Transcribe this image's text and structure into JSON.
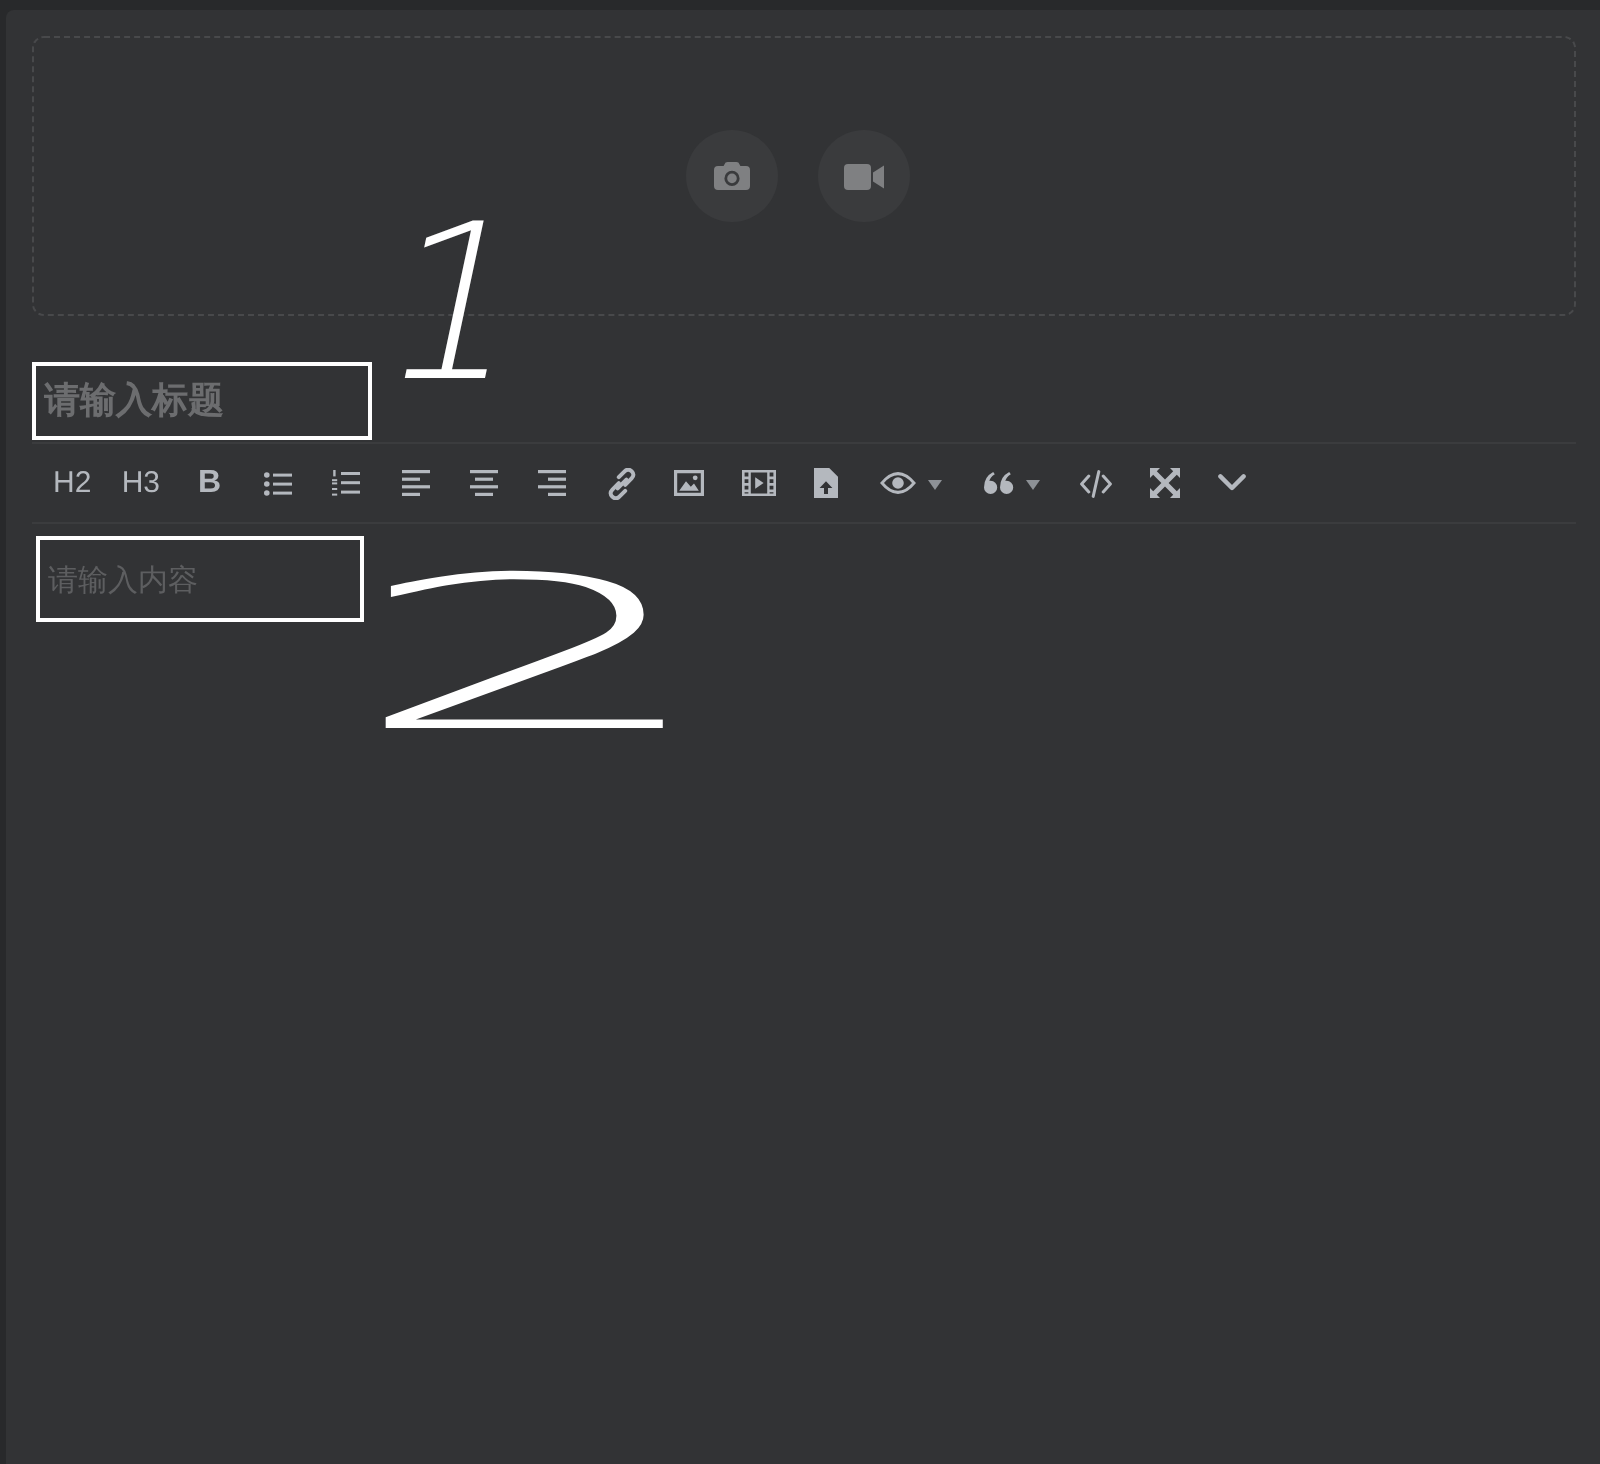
{
  "upload": {
    "buttons": [
      {
        "kind": "photo"
      },
      {
        "kind": "video"
      }
    ]
  },
  "title_field": {
    "placeholder": "请输入标题"
  },
  "toolbar": {
    "heading_buttons": [
      "H2",
      "H3"
    ],
    "bold_button": "B"
  },
  "content_field": {
    "placeholder": "请输入内容"
  },
  "annotations": [
    {
      "label": "1"
    },
    {
      "label": "2"
    }
  ]
}
